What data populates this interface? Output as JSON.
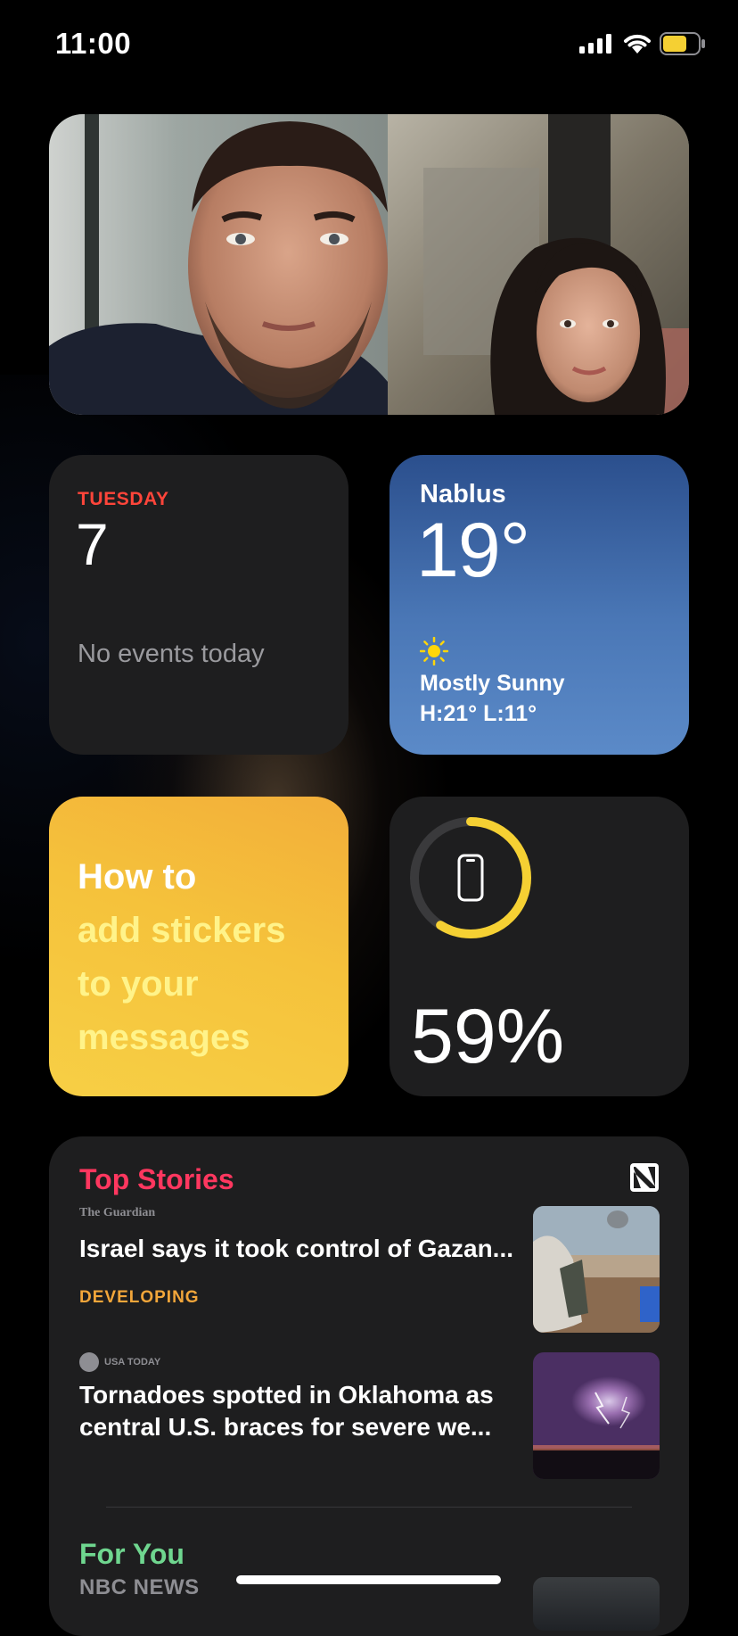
{
  "status_bar": {
    "time": "11:00",
    "battery_color": "#f5d033"
  },
  "calendar": {
    "day": "TUESDAY",
    "date": "7",
    "events_text": "No events today"
  },
  "weather": {
    "city": "Nablus",
    "temperature": "19°",
    "condition": "Mostly Sunny",
    "high_low": "H:21° L:11°",
    "icon": "sun-icon"
  },
  "tips": {
    "line1": "How to",
    "line2": "add stickers",
    "line3": "to your",
    "line4": "messages"
  },
  "battery_widget": {
    "percent_label": "59%",
    "level": 0.59,
    "device_icon": "iphone-icon",
    "ring_color": "#f5d033"
  },
  "news": {
    "top_stories_label": "Top Stories",
    "stories": [
      {
        "source": "The Guardian",
        "headline": "Israel says it took control of Gazan...",
        "tag": "DEVELOPING"
      },
      {
        "source": "USA TODAY",
        "headline": "Tornadoes spotted in Oklahoma as central U.S. braces for severe we..."
      }
    ],
    "for_you_label": "For You",
    "for_you_source": "NBC NEWS"
  },
  "colors": {
    "top_stories": "#ff375f",
    "for_you": "#6fd68f",
    "developing": "#f2a63a",
    "calendar_day": "#ff453a"
  }
}
